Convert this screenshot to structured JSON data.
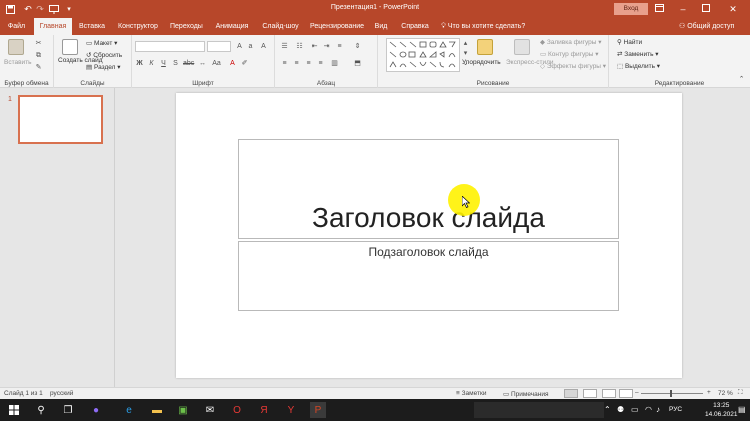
{
  "titlebar": {
    "title": "Презентация1 - PowerPoint",
    "signin": "Вход",
    "icons": {
      "save": "save-icon",
      "undo": "undo-icon",
      "redo": "redo-icon",
      "present": "start-presentation-icon",
      "customize": "customize-toolbar-icon"
    }
  },
  "tabs": {
    "items": [
      "Файл",
      "Главная",
      "Вставка",
      "Конструктор",
      "Переходы",
      "Анимация",
      "Слайд-шоу",
      "Рецензирование",
      "Вид",
      "Справка"
    ],
    "active": "Главная",
    "tell_me": "Что вы хотите сделать?",
    "share": "Общий доступ"
  },
  "ribbon": {
    "clipboard": {
      "label": "Буфер обмена",
      "paste": "Вставить"
    },
    "slides": {
      "label": "Слайды",
      "new_slide": "Создать слайд",
      "layout": "Макет",
      "reset": "Сбросить",
      "section": "Раздел"
    },
    "font": {
      "label": "Шрифт"
    },
    "paragraph": {
      "label": "Абзац"
    },
    "drawing": {
      "label": "Рисование",
      "arrange": "Упорядочить",
      "quick_styles": "Экспресс-стили",
      "fill": "Заливка фигуры",
      "outline": "Контур фигуры",
      "effects": "Эффекты фигуры"
    },
    "editing": {
      "label": "Редактирование",
      "find": "Найти",
      "replace": "Заменить",
      "select": "Выделить"
    }
  },
  "thumbs": {
    "slide_number": "1"
  },
  "slide": {
    "title": "Заголовок слайда",
    "subtitle": "Подзаголовок слайда"
  },
  "status": {
    "slide_info": "Слайд 1 из 1",
    "language": "русский",
    "notes": "Заметки",
    "comments": "Примечания",
    "zoom": "72 %"
  },
  "taskbar": {
    "lang": "РУС",
    "time": "13:25",
    "date": "14.06.2021"
  },
  "colors": {
    "accent": "#b7472a",
    "taskbar": "#1c1c1c"
  }
}
